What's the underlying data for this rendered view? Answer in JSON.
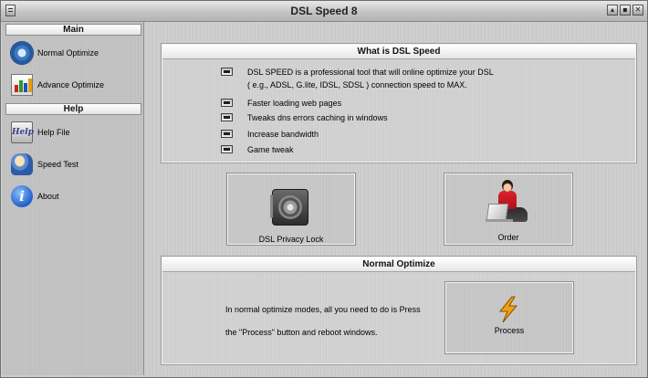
{
  "window": {
    "title": "DSL Speed 8"
  },
  "sidebar": {
    "main_header": "Main",
    "help_header": "Help",
    "items": [
      {
        "label": "Normal Optimize",
        "icon": "gear-icon"
      },
      {
        "label": "Advance Optimize",
        "icon": "chart-icon"
      },
      {
        "label": "Help File",
        "icon": "help-icon"
      },
      {
        "label": "Speed Test",
        "icon": "speed-test-icon"
      },
      {
        "label": "About",
        "icon": "info-icon"
      }
    ]
  },
  "what_is": {
    "title": "What is DSL Speed",
    "intro_line1": "DSL SPEED is a professional tool that will online optimize your DSL",
    "intro_line2": "( e.g., ADSL, G.lite, IDSL, SDSL ) connection speed to MAX.",
    "features": [
      "Faster loading web pages",
      "Tweaks dns errors caching in windows",
      "Increase bandwidth",
      "Game tweak"
    ]
  },
  "buttons": {
    "privacy_lock": "DSL Privacy Lock",
    "order": "Order",
    "process": "Process"
  },
  "normal_optimize": {
    "title": "Normal Optimize",
    "line1": "In normal optimize modes, all you need to do is Press",
    "line2": "the \"Process\" button and reboot windows."
  },
  "colors": {
    "bolt": "#f0a010",
    "shirt": "#d01c24"
  }
}
